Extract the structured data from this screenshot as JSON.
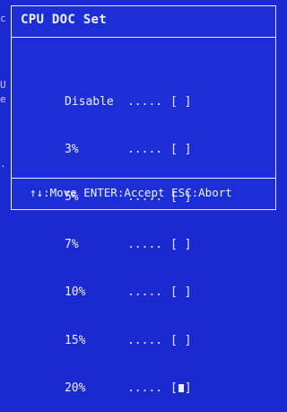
{
  "background": {
    "fragments": [
      "c",
      "U",
      "e",
      "."
    ]
  },
  "dialog": {
    "title": "CPU DOC Set",
    "options": [
      {
        "label": "Disable",
        "dots": ".....",
        "box_open": "[",
        "box_close": "]",
        "selected": false
      },
      {
        "label": "3%",
        "dots": ".....",
        "box_open": "[",
        "box_close": "]",
        "selected": false
      },
      {
        "label": "5%",
        "dots": ".....",
        "box_open": "[",
        "box_close": "]",
        "selected": false
      },
      {
        "label": "7%",
        "dots": ".....",
        "box_open": "[",
        "box_close": "]",
        "selected": false
      },
      {
        "label": "10%",
        "dots": ".....",
        "box_open": "[",
        "box_close": "]",
        "selected": false
      },
      {
        "label": "15%",
        "dots": ".....",
        "box_open": "[",
        "box_close": "]",
        "selected": false
      },
      {
        "label": "20%",
        "dots": ".....",
        "box_open": "[",
        "box_close": "]",
        "selected": true
      }
    ],
    "footer": "↑↓:Move ENTER:Accept ESC:Abort"
  },
  "colors": {
    "background": "#1a2ad0",
    "text": "#eef0ff",
    "border": "#e8ecff"
  }
}
